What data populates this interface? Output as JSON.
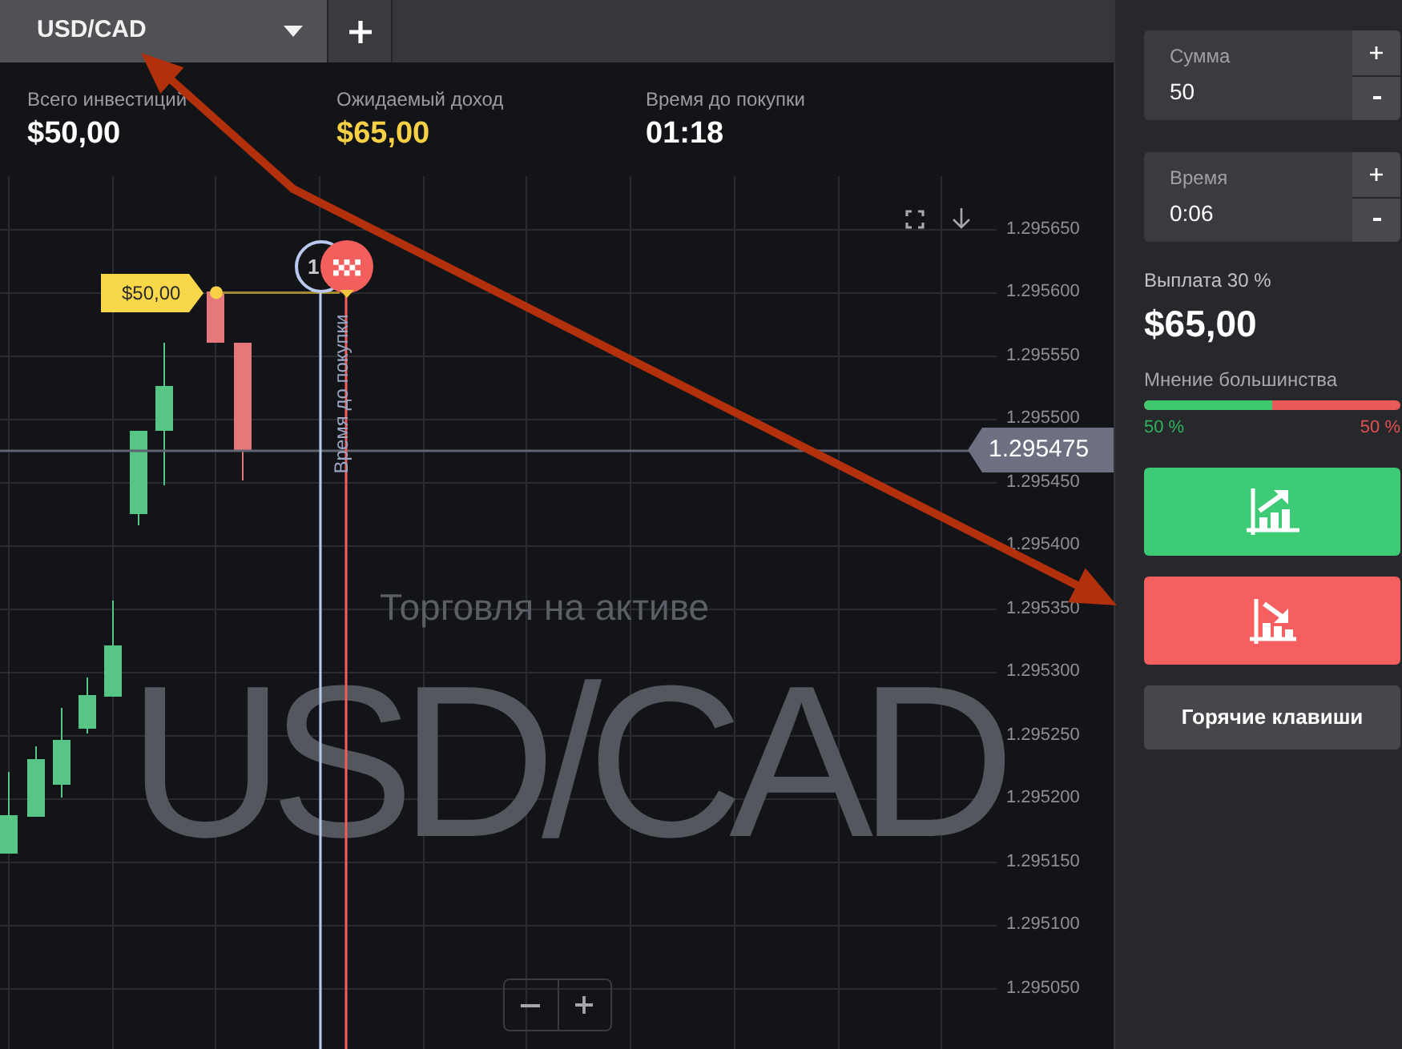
{
  "tab": {
    "label": "USD/CAD"
  },
  "stats": [
    {
      "label": "Всего инвестиций",
      "value": "$50,00",
      "kind": "plain"
    },
    {
      "label": "Ожидаемый доход",
      "value": "$65,00",
      "kind": "accent"
    },
    {
      "label": "Время до покупки",
      "value": "01:18",
      "kind": "plain"
    }
  ],
  "chart": {
    "watermark": "USD/CAD",
    "watermark_caption": "Торговля на активе",
    "price_axis": [
      "1.295650",
      "1.295600",
      "1.295550",
      "1.295500",
      "1.295450",
      "1.295400",
      "1.295350",
      "1.295300",
      "1.295250",
      "1.295200",
      "1.295150",
      "1.295100",
      "1.295050"
    ],
    "current_price": "1.295475",
    "bet_tag": "$50,00",
    "countdown": "1",
    "purchase_line_label": "Время до покупки"
  },
  "sidebar": {
    "fields": [
      {
        "label": "Сумма",
        "value": "50"
      },
      {
        "label": "Время",
        "value": "0:06"
      }
    ],
    "payout_label": "Выплата 30 %",
    "payout": "$65,00",
    "majority": {
      "label": "Мнение большинства",
      "level": 0.5,
      "up_reading": "50 %",
      "down_reading": "50 %"
    },
    "hotkeys_button": "Горячие клавиши"
  }
}
